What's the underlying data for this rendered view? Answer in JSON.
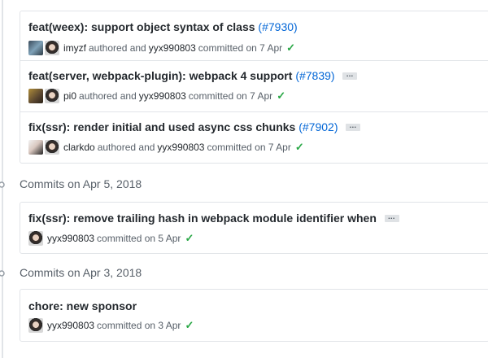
{
  "groups": [
    {
      "heading": "",
      "commits": [
        {
          "message": "feat(weex): support object syntax of class",
          "pr": "(#7930)",
          "has_ellipsis": false,
          "author": "imyzf",
          "authored_text": "authored and",
          "committer": "yyx990803",
          "committed_text": "committed on 7 Apr"
        },
        {
          "message": "feat(server, webpack-plugin): webpack 4 support",
          "pr": "(#7839)",
          "has_ellipsis": true,
          "author": "pi0",
          "authored_text": "authored and",
          "committer": "yyx990803",
          "committed_text": "committed on 7 Apr"
        },
        {
          "message": "fix(ssr): render initial and used async css chunks",
          "pr": "(#7902)",
          "has_ellipsis": true,
          "author": "clarkdo",
          "authored_text": "authored and",
          "committer": "yyx990803",
          "committed_text": "committed on 7 Apr"
        }
      ]
    },
    {
      "heading": "Commits on Apr 5, 2018",
      "commits": [
        {
          "message": "fix(ssr): remove trailing hash in webpack module identifier when",
          "has_ellipsis": true,
          "author": "yyx990803",
          "committed_text": "committed on 5 Apr"
        }
      ]
    },
    {
      "heading": "Commits on Apr 3, 2018",
      "commits": [
        {
          "message": "chore: new sponsor",
          "has_ellipsis": false,
          "author": "yyx990803",
          "committed_text": "committed on 3 Apr"
        }
      ]
    }
  ],
  "status_check": "✓",
  "ellipsis_glyph": "…",
  "colors": {
    "link": "#0366d6",
    "success": "#28a745",
    "border": "#e1e4e8",
    "muted": "#586069"
  }
}
